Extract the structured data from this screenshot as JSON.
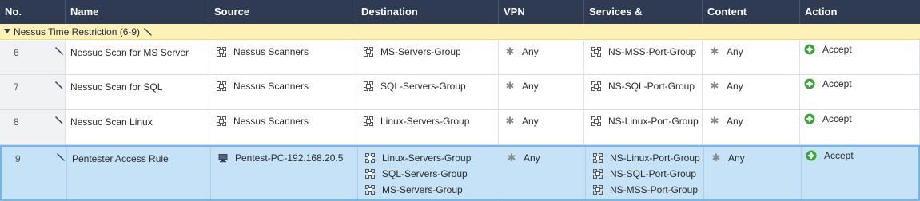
{
  "headers": {
    "no": "No.",
    "name": "Name",
    "source": "Source",
    "destination": "Destination",
    "vpn": "VPN",
    "services": "Services & Applications",
    "content": "Content",
    "action": "Action"
  },
  "section": {
    "label": "Nessus Time Restriction",
    "count": "(6-9)"
  },
  "rows": [
    {
      "no": "6",
      "name": "Nessuc Scan for MS Server",
      "source": [
        "Nessus Scanners"
      ],
      "destination": [
        "MS-Servers-Group"
      ],
      "vpn": "Any",
      "services": [
        "NS-MSS-Port-Group"
      ],
      "content": "Any",
      "action": "Accept"
    },
    {
      "no": "7",
      "name": "Nessuc Scan for SQL",
      "source": [
        "Nessus Scanners"
      ],
      "destination": [
        "SQL-Servers-Group"
      ],
      "vpn": "Any",
      "services": [
        "NS-SQL-Port-Group"
      ],
      "content": "Any",
      "action": "Accept"
    },
    {
      "no": "8",
      "name": "Nessuc Scan Linux",
      "source": [
        "Nessus Scanners"
      ],
      "destination": [
        "Linux-Servers-Group"
      ],
      "vpn": "Any",
      "services": [
        "NS-Linux-Port-Group"
      ],
      "content": "Any",
      "action": "Accept"
    },
    {
      "no": "9",
      "name": "Pentester Access Rule",
      "source": [
        "Pentest-PC-192.168.20.5"
      ],
      "destination": [
        "Linux-Servers-Group",
        "SQL-Servers-Group",
        "MS-Servers-Group"
      ],
      "vpn": "Any",
      "services": [
        "NS-Linux-Port-Group",
        "NS-SQL-Port-Group",
        "NS-MSS-Port-Group"
      ],
      "content": "Any",
      "action": "Accept",
      "selected": true,
      "source_icon": "computer-icon"
    }
  ],
  "colors": {
    "header_bg": "#2f3b52",
    "section_bg": "#fdf1b8",
    "selected_bg": "#c6e2f7",
    "selected_border": "#74b6ea",
    "accept_green": "#3aa63a"
  }
}
